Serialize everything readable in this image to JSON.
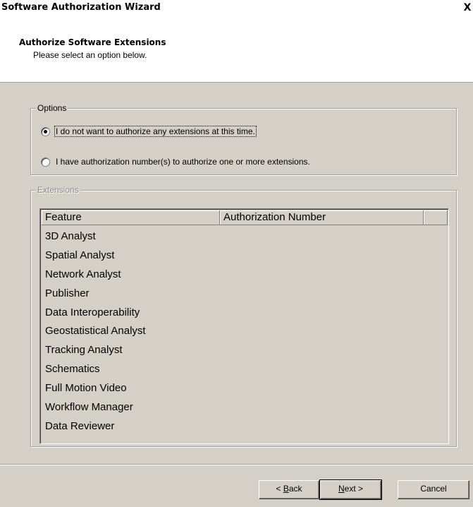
{
  "window": {
    "title": "Software Authorization Wizard",
    "close_glyph": "X"
  },
  "header": {
    "title": "Authorize Software Extensions",
    "subtitle": "Please select an option below."
  },
  "options": {
    "legend": "Options",
    "radio1": {
      "label": "I do not want to authorize any extensions at this time.",
      "selected": true
    },
    "radio2": {
      "label": "I have authorization number(s) to authorize one or more extensions.",
      "selected": false
    }
  },
  "extensions": {
    "legend": "Extensions",
    "enabled": false,
    "columns": [
      "Feature",
      "Authorization Number"
    ],
    "rows": [
      {
        "feature": "3D Analyst",
        "authorization_number": ""
      },
      {
        "feature": "Spatial Analyst",
        "authorization_number": ""
      },
      {
        "feature": "Network Analyst",
        "authorization_number": ""
      },
      {
        "feature": "Publisher",
        "authorization_number": ""
      },
      {
        "feature": "Data Interoperability",
        "authorization_number": ""
      },
      {
        "feature": "Geostatistical Analyst",
        "authorization_number": ""
      },
      {
        "feature": "Tracking Analyst",
        "authorization_number": ""
      },
      {
        "feature": "Schematics",
        "authorization_number": ""
      },
      {
        "feature": "Full Motion Video",
        "authorization_number": ""
      },
      {
        "feature": "Workflow Manager",
        "authorization_number": ""
      },
      {
        "feature": "Data Reviewer",
        "authorization_number": ""
      }
    ]
  },
  "buttons": {
    "back": {
      "prefix": "< ",
      "mnemonic": "B",
      "rest": "ack"
    },
    "next": {
      "mnemonic": "N",
      "rest": "ext >"
    },
    "cancel": "Cancel"
  },
  "colors": {
    "dialog_face": "#d4d0c8",
    "header_bg": "#ffffff",
    "disabled_text": "#8c8c8c"
  }
}
